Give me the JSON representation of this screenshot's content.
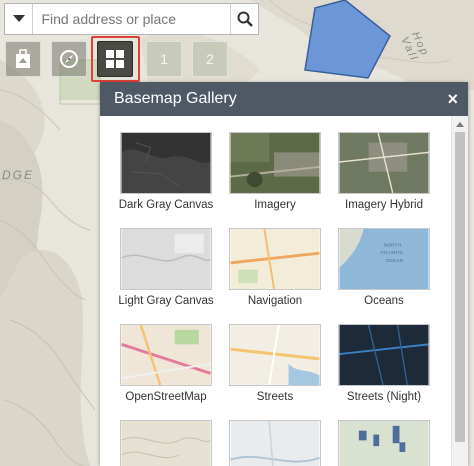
{
  "search": {
    "placeholder": "Find address or place"
  },
  "toolbar": {
    "bookmark_number_1": "1",
    "bookmark_number_2": "2"
  },
  "map": {
    "label_ridge": "DGE",
    "label_hop_valley": "Hop Vall"
  },
  "panel": {
    "title": "Basemap Gallery",
    "close_label": "×",
    "items": [
      {
        "label": "Dark Gray Canvas"
      },
      {
        "label": "Imagery"
      },
      {
        "label": "Imagery Hybrid"
      },
      {
        "label": "Light Gray Canvas"
      },
      {
        "label": "Navigation"
      },
      {
        "label": "Oceans"
      },
      {
        "label": "OpenStreetMap"
      },
      {
        "label": "Streets"
      },
      {
        "label": "Streets (Night)"
      },
      {
        "label": ""
      },
      {
        "label": ""
      },
      {
        "label": ""
      }
    ],
    "oceans_thumb_text_1": "NORTH",
    "oceans_thumb_text_2": "ATLANTIC",
    "oceans_thumb_text_3": "OCEAN"
  },
  "colors": {
    "panel_header": "#4f5966",
    "highlight_border": "#e0403a",
    "polygon_fill": "#6b97d8"
  }
}
